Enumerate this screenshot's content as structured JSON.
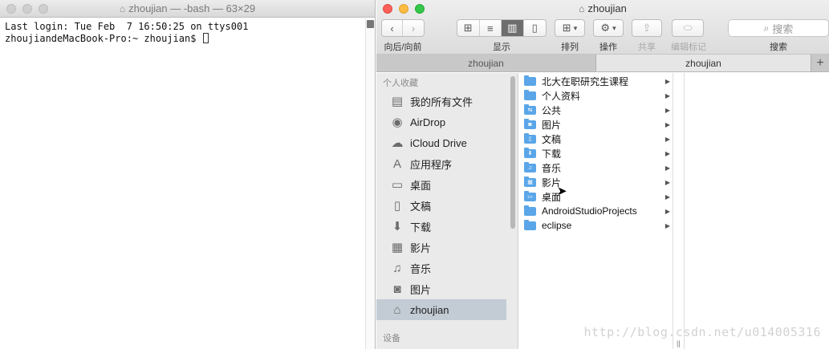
{
  "terminal": {
    "title": "zhoujian — -bash — 63×29",
    "lines": [
      "Last login: Tue Feb  7 16:50:25 on ttys001",
      "zhoujiandeMacBook-Pro:~ zhoujian$ "
    ]
  },
  "finder": {
    "title": "zhoujian",
    "toolbar": {
      "nav_label": "向后/向前",
      "view_label": "显示",
      "arrange_label": "排列",
      "action_label": "操作",
      "share_label": "共享",
      "tags_label": "编辑标记",
      "search_label": "搜索",
      "search_placeholder": "搜索"
    },
    "tabs": [
      "zhoujian",
      "zhoujian"
    ],
    "tab_add": "+",
    "sidebar": {
      "favorites_header": "个人收藏",
      "devices_header": "设备",
      "items": [
        {
          "label": "我的所有文件",
          "icon": "all-files-icon",
          "glyph": "▤"
        },
        {
          "label": "AirDrop",
          "icon": "airdrop-icon",
          "glyph": "◉"
        },
        {
          "label": "iCloud Drive",
          "icon": "cloud-icon",
          "glyph": "☁"
        },
        {
          "label": "应用程序",
          "icon": "applications-icon",
          "glyph": "A"
        },
        {
          "label": "桌面",
          "icon": "desktop-icon",
          "glyph": "▭"
        },
        {
          "label": "文稿",
          "icon": "documents-icon",
          "glyph": "▯"
        },
        {
          "label": "下载",
          "icon": "downloads-icon",
          "glyph": "⬇"
        },
        {
          "label": "影片",
          "icon": "movies-icon",
          "glyph": "▦"
        },
        {
          "label": "音乐",
          "icon": "music-icon",
          "glyph": "♫"
        },
        {
          "label": "图片",
          "icon": "pictures-icon",
          "glyph": "◙"
        },
        {
          "label": "zhoujian",
          "icon": "home-icon",
          "glyph": "⌂",
          "selected": true
        }
      ]
    },
    "column1": [
      {
        "label": "北大在职研究生课程",
        "badge": ""
      },
      {
        "label": "个人资料",
        "badge": ""
      },
      {
        "label": "公共",
        "badge": "⇆"
      },
      {
        "label": "图片",
        "badge": "◙"
      },
      {
        "label": "文稿",
        "badge": "▯"
      },
      {
        "label": "下载",
        "badge": "⬇"
      },
      {
        "label": "音乐",
        "badge": "♫"
      },
      {
        "label": "影片",
        "badge": "▦"
      },
      {
        "label": "桌面",
        "badge": "▭"
      },
      {
        "label": "AndroidStudioProjects",
        "badge": ""
      },
      {
        "label": "eclipse",
        "badge": ""
      }
    ],
    "column_resize_glyph": "||"
  },
  "watermark": "http://blog.csdn.net/u014005316"
}
